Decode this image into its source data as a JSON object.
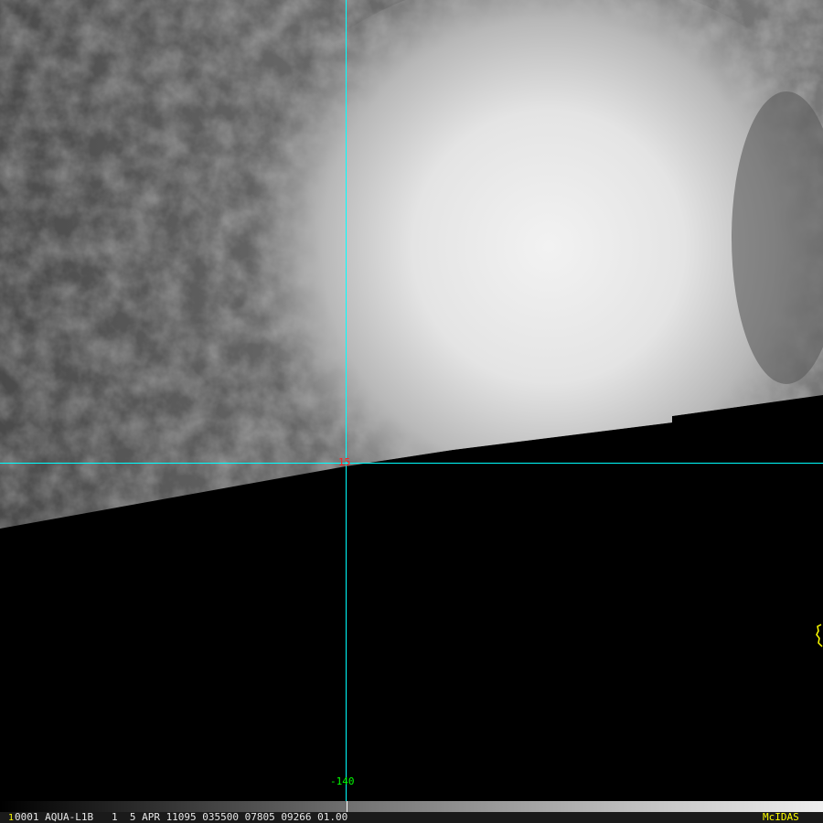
{
  "image": {
    "grid_latitude_label": "15",
    "grid_longitude_label": "-140",
    "colors": {
      "grid": "#00ffff",
      "lat_label": "#ff2020",
      "lon_label": "#00ff00",
      "coastline": "#ffff00",
      "status_accent": "#ffff00"
    }
  },
  "status_bar": {
    "frame_number": "1",
    "text": "0001 AQUA-L1B   1  5 APR 11095 035500 07805 09266 01.00",
    "brand": "McIDAS"
  }
}
